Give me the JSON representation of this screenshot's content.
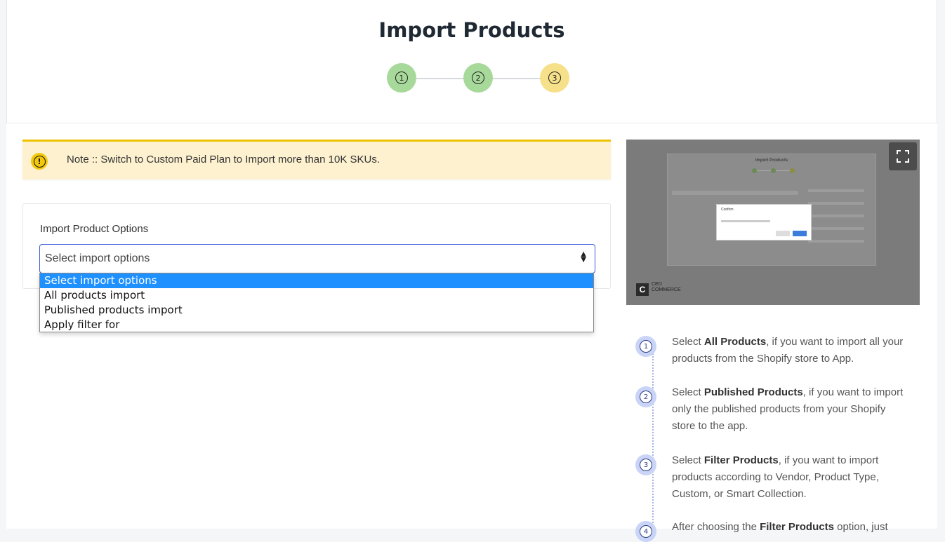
{
  "header": {
    "title": "Import Products",
    "steps": [
      "1",
      "2",
      "3"
    ]
  },
  "note": {
    "text": "Note :: Switch to Custom Paid Plan to Import more than 10K SKUs.",
    "icon": "!"
  },
  "import_options": {
    "label": "Import Product Options",
    "selected": "Select import options",
    "options": [
      "Select import options",
      "All products import",
      "Published products import",
      "Apply filter for"
    ]
  },
  "preview": {
    "title": "Import Products",
    "dialog_title": "Confirm",
    "logo_mark": "C",
    "logo_text_1": "CED",
    "logo_text_2": "COMMERCE"
  },
  "instructions": [
    {
      "num": "1",
      "pre": "Select ",
      "bold": "All Products",
      "post": ", if you want to import all your products from the Shopify store to App."
    },
    {
      "num": "2",
      "pre": "Select ",
      "bold": "Published Products",
      "post": ", if you want to import only the published products from your Shopify store to the app."
    },
    {
      "num": "3",
      "pre": "Select ",
      "bold": "Filter Products",
      "post": ", if you want to import products according to Vendor, Product Type, Custom, or Smart Collection."
    },
    {
      "num": "4",
      "pre": "After choosing the ",
      "bold": "Filter Products",
      "post": " option, just"
    }
  ],
  "colors": {
    "step_done": "#a7d99a",
    "step_active": "#f6e08a",
    "note_bg": "#fdf1cf",
    "note_border": "#eec200",
    "select_border": "#3b5bdb",
    "dropdown_selected": "#1e90ff"
  }
}
